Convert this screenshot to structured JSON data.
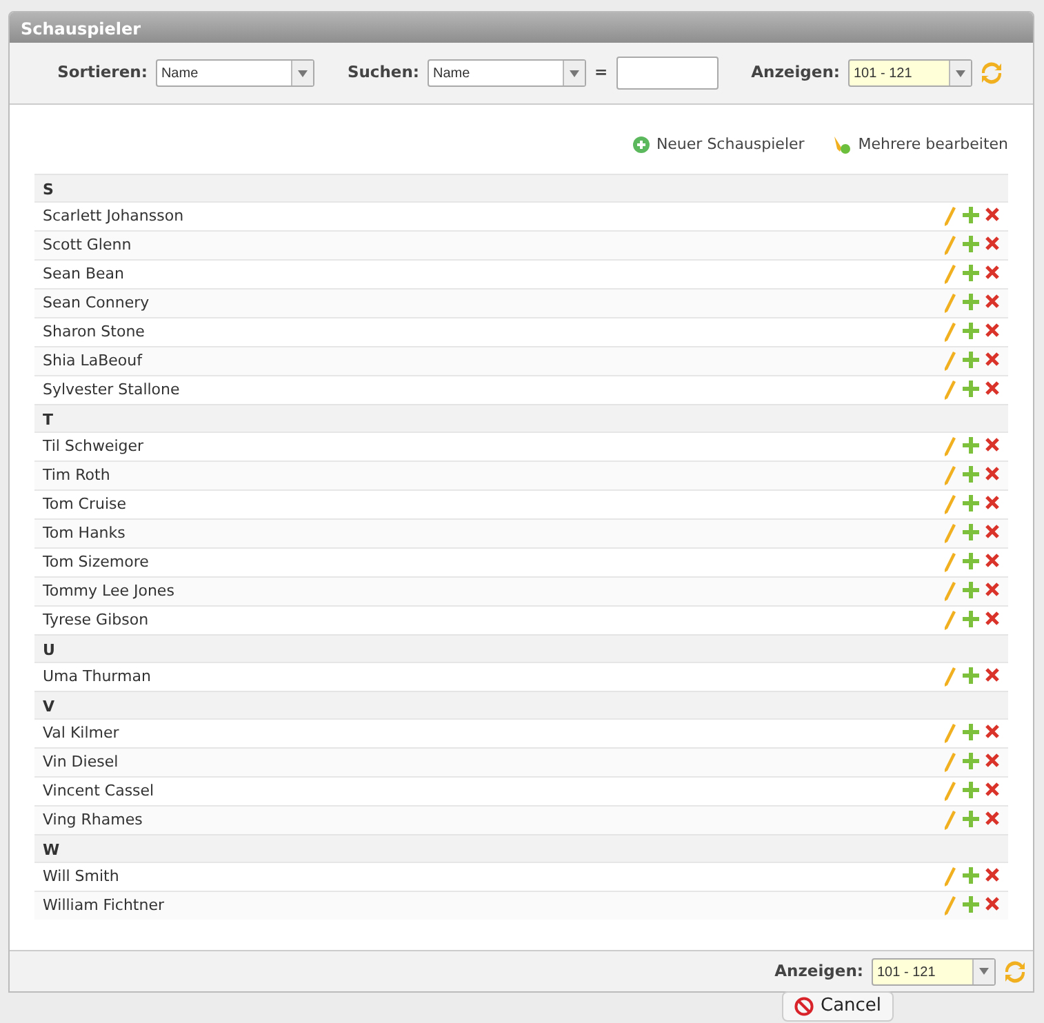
{
  "window": {
    "title": "Schauspieler"
  },
  "toolbar": {
    "sort_label": "Sortieren:",
    "sort_value": "Name",
    "search_label": "Suchen:",
    "search_field": "Name",
    "equals": "=",
    "show_label": "Anzeigen:",
    "show_value": "101 - 121"
  },
  "actions": [
    {
      "kind": "new",
      "label": "Neuer Schauspieler"
    },
    {
      "kind": "edit",
      "label": "Mehrere bearbeiten"
    }
  ],
  "groups": [
    {
      "letter": "S",
      "actors": [
        "Scarlett Johansson",
        "Scott Glenn",
        "Sean Bean",
        "Sean Connery",
        "Sharon Stone",
        "Shia LaBeouf",
        "Sylvester Stallone"
      ]
    },
    {
      "letter": "T",
      "actors": [
        "Til Schweiger",
        "Tim Roth",
        "Tom Cruise",
        "Tom Hanks",
        "Tom Sizemore",
        "Tommy Lee Jones",
        "Tyrese Gibson"
      ]
    },
    {
      "letter": "U",
      "actors": [
        "Uma Thurman"
      ]
    },
    {
      "letter": "V",
      "actors": [
        "Val Kilmer",
        "Vin Diesel",
        "Vincent Cassel",
        "Ving Rhames"
      ]
    },
    {
      "letter": "W",
      "actors": [
        "Will Smith",
        "William Fichtner"
      ]
    }
  ],
  "footer": {
    "show_label": "Anzeigen:",
    "show_value": "101 - 121"
  },
  "cancel_button": "Cancel"
}
